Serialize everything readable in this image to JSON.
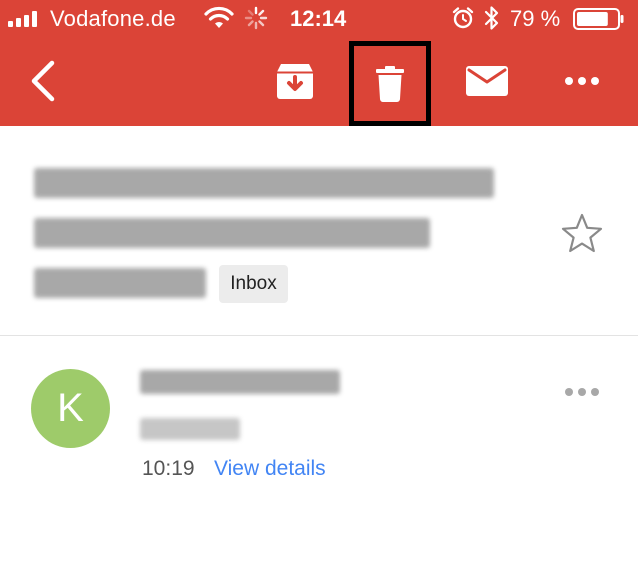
{
  "status_bar": {
    "carrier": "Vodafone.de",
    "time": "12:14",
    "battery_percent": "79 %",
    "battery_level": 0.79
  },
  "toolbar": {
    "back_icon": "chevron-left-icon",
    "archive_icon": "archive-icon",
    "delete_icon": "trash-icon",
    "mark_unread_icon": "envelope-icon",
    "more_icon": "more-horizontal-icon"
  },
  "subject": {
    "label_chip": "Inbox",
    "star_icon": "star-outline-icon"
  },
  "message": {
    "avatar_letter": "K",
    "avatar_color": "#9ECB6A",
    "time": "10:19",
    "view_details_label": "View details"
  },
  "colors": {
    "accent": "#DB4437",
    "link": "#4285F4"
  }
}
